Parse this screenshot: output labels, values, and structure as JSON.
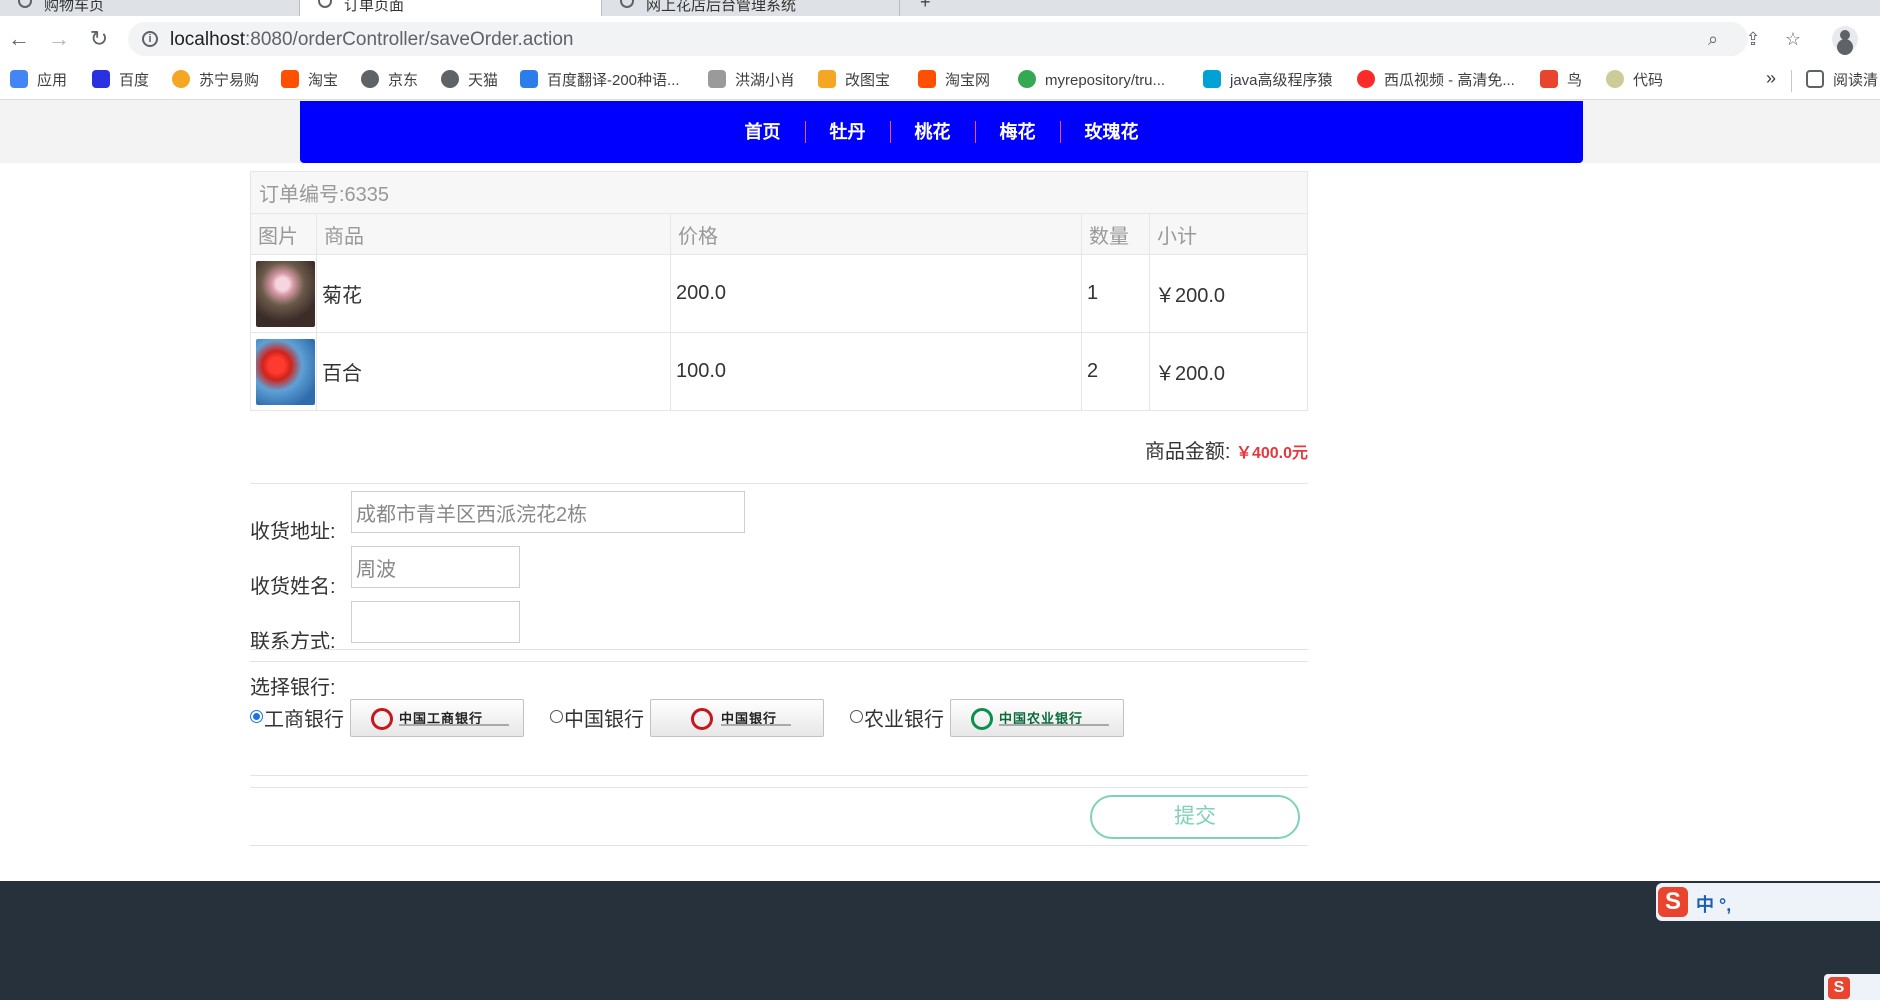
{
  "browser": {
    "tabs": [
      {
        "title": "购物车页"
      },
      {
        "title": "订单页面"
      },
      {
        "title": "网上花店后台管理系统"
      }
    ],
    "url_host": "localhost",
    "url_path": ":8080/orderController/saveOrder.action",
    "bookmarks": [
      {
        "label": "应用",
        "icon": "apps-grid-icon",
        "color": "#4285f4"
      },
      {
        "label": "百度",
        "icon": "baidu-paw-icon",
        "color": "#2932e1"
      },
      {
        "label": "苏宁易购",
        "icon": "suning-icon",
        "color": "#f5a623"
      },
      {
        "label": "淘宝",
        "icon": "taobao-icon",
        "color": "#ff5000"
      },
      {
        "label": "京东",
        "icon": "globe-icon",
        "color": "#5f6368"
      },
      {
        "label": "天猫",
        "icon": "globe-icon",
        "color": "#5f6368"
      },
      {
        "label": "百度翻译-200种语...",
        "icon": "translate-icon",
        "color": "#2b7de9"
      },
      {
        "label": "洪湖小肖",
        "icon": "bird-icon",
        "color": "#777777"
      },
      {
        "label": "改图宝",
        "icon": "gaitubao-icon",
        "color": "#f5a623"
      },
      {
        "label": "淘宝网",
        "icon": "taobao-icon",
        "color": "#ff5000"
      },
      {
        "label": "myrepository/tru...",
        "icon": "chrome-icon",
        "color": "#34a853"
      },
      {
        "label": "java高级程序猿",
        "icon": "bilibili-icon",
        "color": "#00a1d6"
      },
      {
        "label": "西瓜视频 - 高清免...",
        "icon": "xigua-icon",
        "color": "#ff2b2b"
      },
      {
        "label": "鸟",
        "icon": "bird-icon",
        "color": "#e8442e"
      },
      {
        "label": "代码",
        "icon": "code-icon",
        "color": "#cccc99"
      }
    ],
    "bookmarks_more": "»",
    "reading_list": "阅读清"
  },
  "nav": {
    "items": [
      "首页",
      "牡丹",
      "桃花",
      "梅花",
      "玫瑰花"
    ],
    "accent": "#0000ff"
  },
  "order": {
    "caption": "订单编号:6335",
    "headers": [
      "图片",
      "商品",
      "价格",
      "数量",
      "小计"
    ],
    "items": [
      {
        "name": "菊花",
        "price": "200.0",
        "qty": "1",
        "subtotal": "￥200.0"
      },
      {
        "name": "百合",
        "price": "100.0",
        "qty": "2",
        "subtotal": "￥200.0"
      }
    ],
    "total_label": "商品金额:",
    "total_value": "￥400.0元"
  },
  "form": {
    "address_label": "收货地址:",
    "address_value": "成都市青羊区西派浣花2栋",
    "name_label": "收货姓名:",
    "name_value": "周波",
    "phone_label": "联系方式:",
    "phone_value": ""
  },
  "bank": {
    "label": "选择银行:",
    "options": [
      {
        "name": "工商银行",
        "logo_text": "中国工商银行",
        "checked": true
      },
      {
        "name": "中国银行",
        "logo_text": "中国银行",
        "checked": false
      },
      {
        "name": "农业银行",
        "logo_text": "中国农业银行",
        "checked": false
      }
    ]
  },
  "submit_label": "提交",
  "ime": {
    "label": "中 °,"
  }
}
